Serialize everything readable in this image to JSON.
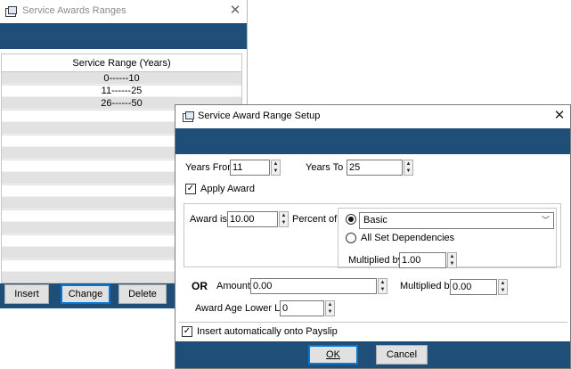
{
  "back_window": {
    "title": "Service Awards Ranges",
    "list_header": "Service Range (Years)",
    "rows": [
      "0------10",
      "11------25",
      "26------50"
    ],
    "buttons": {
      "insert": "Insert",
      "change": "Change",
      "delete": "Delete"
    }
  },
  "dialog": {
    "title": "Service Award Range Setup",
    "years_from_label": "Years From",
    "years_from_value": "11",
    "years_to_label": "Years To",
    "years_to_value": "25",
    "apply_award_label": "Apply Award",
    "apply_award_checked": true,
    "award_is_label": "Award is",
    "award_is_value": "10.00",
    "percent_of_label": "Percent of",
    "basis_option_selected": "Basic",
    "all_set_dependencies_label": "All Set Dependencies",
    "multiplied_by_label": "Multiplied by",
    "multiplied_by_value": "1.00",
    "or_label": "OR",
    "amount_label": "Amount",
    "amount_value": "0.00",
    "multiplied_by_2_label": "Multiplied by",
    "multiplied_by_2_value": "0.00",
    "award_age_lower_limit_label": "Award Age Lower Limit",
    "award_age_lower_limit_value": "0",
    "insert_auto_label": "Insert automatically onto Payslip",
    "insert_auto_checked": true,
    "buttons": {
      "ok": "OK",
      "cancel": "Cancel"
    }
  },
  "colors": {
    "band": "#1f4e79",
    "focus": "#0078d7"
  }
}
